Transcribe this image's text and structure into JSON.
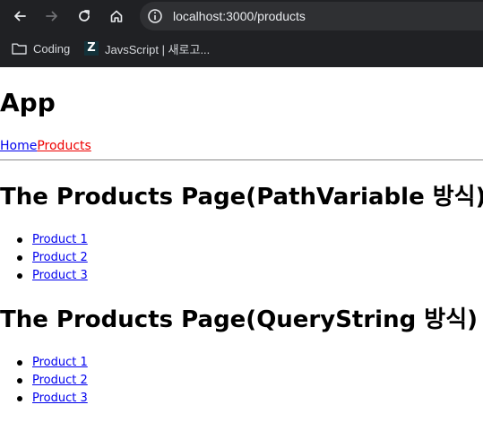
{
  "browser": {
    "url": "localhost:3000/products",
    "bookmarks": [
      {
        "label": "Coding",
        "icon": "folder-icon"
      },
      {
        "label": "JavsScript | 새로고...",
        "icon": "z-site-icon"
      }
    ]
  },
  "page": {
    "app_title": "App",
    "nav": {
      "home": "Home",
      "products": "Products"
    },
    "sections": [
      {
        "title": "The Products Page(PathVariable 방식)",
        "items": [
          "Product 1",
          "Product 2",
          "Product 3"
        ]
      },
      {
        "title": "The Products Page(QueryString 방식)",
        "items": [
          "Product 1",
          "Product 2",
          "Product 3"
        ]
      }
    ]
  },
  "colors": {
    "chrome_bg": "#202124",
    "link": "#0000ee",
    "active_link": "#ee0000"
  }
}
